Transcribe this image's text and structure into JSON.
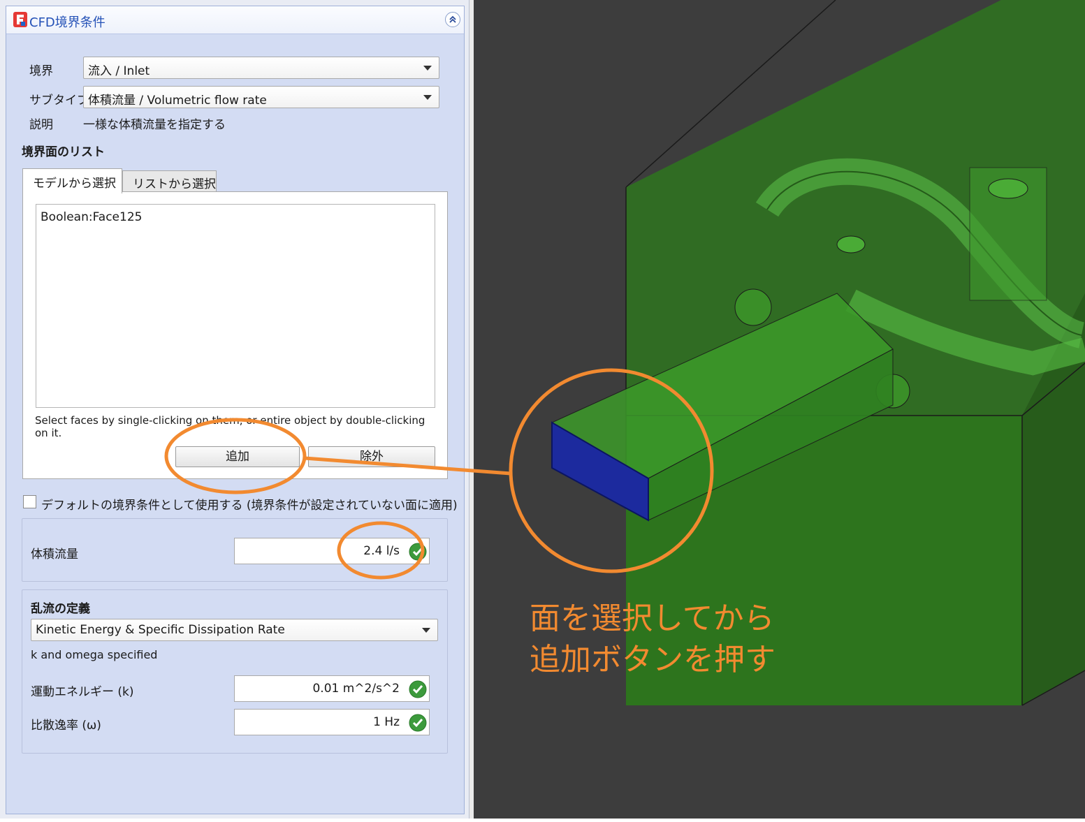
{
  "panel": {
    "title": "CFD境界条件"
  },
  "boundary": {
    "label": "境界",
    "value": "流入 / Inlet"
  },
  "subtype": {
    "label": "サブタイプ",
    "value": "体積流量 / Volumetric flow rate"
  },
  "description": {
    "label": "説明",
    "value": "一様な体積流量を指定する"
  },
  "face_list": {
    "title": "境界面のリスト",
    "tabs": [
      "モデルから選択",
      "リストから選択"
    ],
    "items": [
      "Boolean:Face125"
    ],
    "hint": "Select faces by single-clicking on them, or entire object by double-clicking on it.",
    "add_label": "追加",
    "remove_label": "除外"
  },
  "default_bc": {
    "label": "デフォルトの境界条件として使用する (境界条件が設定されていない面に適用)",
    "checked": false
  },
  "flow_rate": {
    "label": "体積流量",
    "value": "2.4 l/s"
  },
  "turbulence": {
    "title": "乱流の定義",
    "model": "Kinetic Energy & Specific Dissipation Rate",
    "note": "k and omega specified",
    "k_label": "運動エネルギー (k)",
    "k_value": "0.01 m^2/s^2",
    "omega_label": "比散逸率 (ω)",
    "omega_value": "1 Hz"
  },
  "annotation": {
    "line1": "面を選択してから",
    "line2": "追加ボタンを押す",
    "color": "#f28a30"
  },
  "colors": {
    "model_green": "#2e7d1f",
    "selected_face": "#1c2a9e",
    "viewport_bg": "#3d3d3d",
    "title_blue": "#2451b7"
  }
}
